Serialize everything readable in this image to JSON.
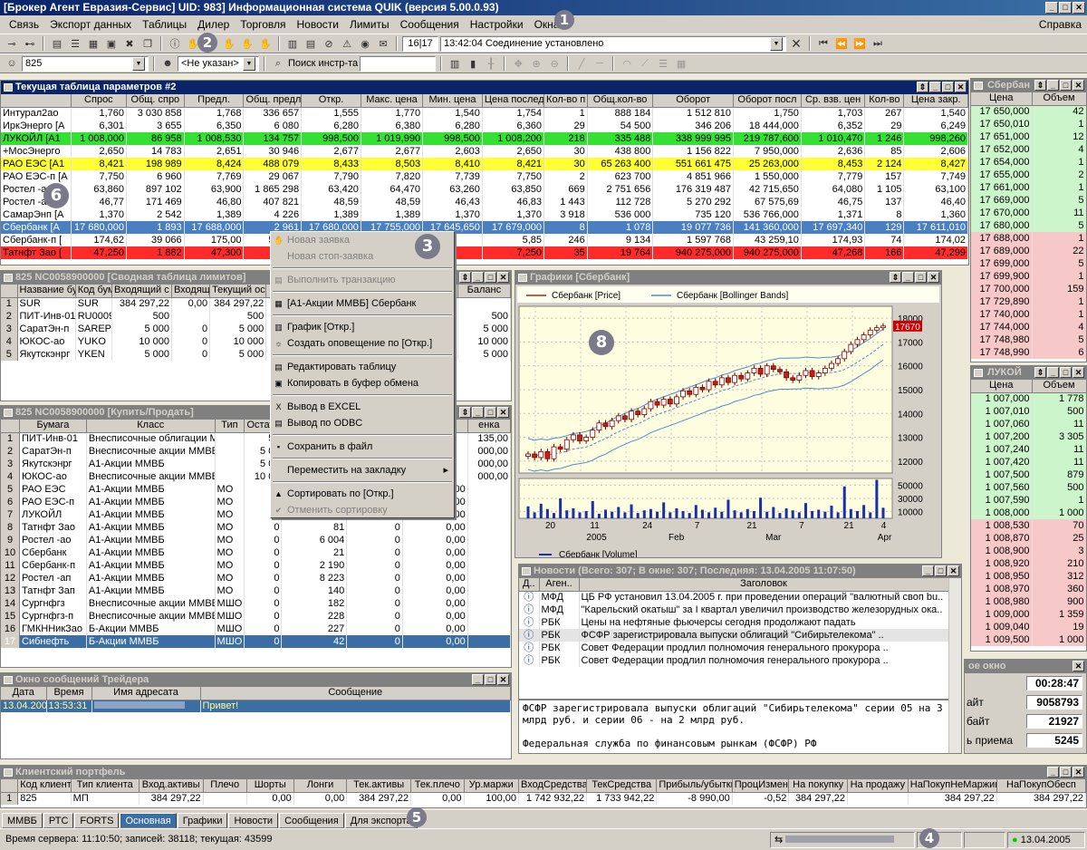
{
  "window": {
    "title": "[Брокер Агент Евразия-Сервис] UID: 983] Информационная система QUIK (версия 5.00.0.93)"
  },
  "menu": {
    "items": [
      "Связь",
      "Экспорт данных",
      "Таблицы",
      "Дилер",
      "Торговля",
      "Новости",
      "Лимиты",
      "Сообщения",
      "Настройки",
      "Окна"
    ],
    "help": "Справка"
  },
  "toolbar2": {
    "account": "825",
    "client_combo": "<Не указан>",
    "search_label": "Поиск инстр-та"
  },
  "toolbar1": {
    "counter": "16|17",
    "status": "13:42:04  Соединение установлено"
  },
  "badges": [
    "1",
    "2",
    "3",
    "4",
    "5",
    "6",
    "7",
    "8"
  ],
  "params": {
    "title": "Текущая таблица параметров #2",
    "headers": [
      "",
      "Спрос",
      "Общ. спро",
      "Предл.",
      "Общ. предл",
      "Откр.",
      "Макс. цена",
      "Мин. цена",
      "Цена послед",
      "Кол-во п",
      "Общ.кол-во",
      "Оборот",
      "Оборот посл",
      "Ср. взв. цен",
      "Кол-во",
      "Цена закр."
    ],
    "rows": [
      {
        "c": [
          "Интурал2ао",
          "1,760",
          "3 030 858",
          "1,768",
          "336 657",
          "1,555",
          "1,770",
          "1,540",
          "1,754",
          "1",
          "888 184",
          "1 512 810",
          "1,750",
          "1,703",
          "267",
          "1,540"
        ],
        "bg": "#ffffff"
      },
      {
        "c": [
          "ИркЭнерго [A",
          "6,301",
          "3 655",
          "6,350",
          "6 080",
          "6,280",
          "6,380",
          "6,280",
          "6,360",
          "29",
          "54 500",
          "346 206",
          "18 444,000",
          "6,352",
          "29",
          "6,249"
        ],
        "bg": "#ffffff"
      },
      {
        "c": [
          "ЛУКОЙЛ [A1",
          "1 008,000",
          "86 958",
          "1 008,530",
          "134 757",
          "998,500",
          "1 019,990",
          "998,500",
          "1 008,200",
          "218",
          "335 488",
          "338 999 995",
          "219 787,600",
          "1 010,470",
          "1 246",
          "998,260"
        ],
        "bg": "#33e033"
      },
      {
        "c": [
          "+МосЭнерго",
          "2,650",
          "14 783",
          "2,651",
          "30 946",
          "2,677",
          "2,677",
          "2,603",
          "2,650",
          "30",
          "438 800",
          "1 156 822",
          "7 950,000",
          "2,636",
          "85",
          "2,606"
        ],
        "bg": "#ffffff"
      },
      {
        "c": [
          "РАО ЕЭС [A1",
          "8,421",
          "198 989",
          "8,424",
          "488 079",
          "8,433",
          "8,503",
          "8,410",
          "8,421",
          "30",
          "65 263 400",
          "551 661 475",
          "25 263,000",
          "8,453",
          "2 124",
          "8,427"
        ],
        "bg": "#ffff33"
      },
      {
        "c": [
          "РАО ЕЭС-п [А",
          "7,750",
          "6 960",
          "7,769",
          "29 067",
          "7,790",
          "7,820",
          "7,739",
          "7,750",
          "2",
          "623 700",
          "4 851 966",
          "1 550,000",
          "7,779",
          "157",
          "7,749"
        ],
        "bg": "#ffffff"
      },
      {
        "c": [
          "Ростел -ао",
          "63,860",
          "897 102",
          "63,900",
          "1 865 298",
          "63,420",
          "64,470",
          "63,260",
          "63,850",
          "669",
          "2 751 656",
          "176 319 487",
          "42 715,650",
          "64,080",
          "1 105",
          "63,100"
        ],
        "bg": "#ffffff"
      },
      {
        "c": [
          "Ростел -ап",
          "46,77",
          "171 469",
          "46,80",
          "407 821",
          "48,59",
          "48,59",
          "46,43",
          "46,83",
          "1 443",
          "112 728",
          "5 270 292",
          "67 575,69",
          "46,75",
          "137",
          "46,40"
        ],
        "bg": "#ffffff"
      },
      {
        "c": [
          "СамарЭнп [A",
          "1,370",
          "2 542",
          "1,389",
          "4 226",
          "1,389",
          "1,389",
          "1,370",
          "1,370",
          "3 918",
          "536 000",
          "735 120",
          "536 766,000",
          "1,371",
          "8",
          "1,360"
        ],
        "bg": "#ffffff"
      },
      {
        "c": [
          "Сбербанк [А",
          "17 680,000",
          "1 893",
          "17 688,000",
          "2 961",
          "17 680,000",
          "17 755,000",
          "17 645,650",
          "17 679,000",
          "8",
          "1 078",
          "19 077 736",
          "141 360,000",
          "17 697,340",
          "129",
          "17 611,010"
        ],
        "bg": "#4a7fc0",
        "fg": "#ffffff"
      },
      {
        "c": [
          "Сбербанк-п [",
          "174,62",
          "39 066",
          "175,00",
          "59 249",
          "",
          "",
          "",
          "5,85",
          "246",
          "9 134",
          "1 597 768",
          "43 259,10",
          "174,93",
          "74",
          "174,02"
        ],
        "bg": "#ffffff"
      },
      {
        "c": [
          "Татнфт Зао [",
          "47,250",
          "1 882",
          "47,300",
          "2 168",
          "",
          "",
          "",
          "7,250",
          "35",
          "19 764",
          "940 275,000",
          "940 275,000",
          "47,268",
          "166",
          "47,299"
        ],
        "bg": "#ff2a2a"
      }
    ]
  },
  "limits": {
    "title": "825 NC0058900000 [Сводная таблица лимитов]",
    "headers": [
      "",
      "Название бум",
      "Код бум",
      "Входящий с",
      "Входящ",
      "Текущий ос",
      "Те"
    ],
    "balance_header": "Баланс",
    "rows": [
      [
        "1",
        "SUR",
        "SUR",
        "384 297,22",
        "0,00",
        "384 297,22"
      ],
      [
        "2",
        "ПИТ-Инв-01",
        "RU0009",
        "500",
        "",
        "500"
      ],
      [
        "3",
        "СаратЭн-п",
        "SAREP",
        "5 000",
        "0",
        "5 000"
      ],
      [
        "4",
        "ЮКОС-ао",
        "YUKO",
        "10 000",
        "0",
        "10 000"
      ],
      [
        "5",
        "Якутскэнрг",
        "YKEN",
        "5 000",
        "0",
        "5 000"
      ]
    ],
    "balances": [
      "",
      "500",
      "5 000",
      "10 000",
      "5 000"
    ]
  },
  "buysell": {
    "title": "825 NC0058900000 [Купить/Продать]",
    "headers": [
      "",
      "Бумага",
      "Класс",
      "Тип",
      "Остато"
    ],
    "right_header": "енка",
    "rows": [
      [
        "1",
        "ПИТ-Инв-01",
        "Внесписочные облигации М",
        "",
        "50"
      ],
      [
        "2",
        "СаратЭн-п",
        "Внесписочные акции ММВБ",
        "",
        "5 00"
      ],
      [
        "3",
        "Якутскэнрг",
        "А1-Акции ММВБ",
        "",
        "5 00"
      ],
      [
        "4",
        "ЮКОС-ао",
        "Внесписочные акции ММВБ",
        "",
        "10 00"
      ],
      [
        "5",
        "РАО ЕЭС",
        "А1-Акции ММВБ",
        "МО",
        "0"
      ],
      [
        "6",
        "РАО ЕЭС-п",
        "А1-Акции ММВБ",
        "МО",
        "0"
      ],
      [
        "7",
        "ЛУКОЙЛ",
        "А1-Акции ММВБ",
        "МО",
        "0"
      ],
      [
        "8",
        "Татнфт Зао",
        "А1-Акции ММВБ",
        "МО",
        "0"
      ],
      [
        "9",
        "Ростел -ао",
        "А1-Акции ММВБ",
        "МО",
        "0"
      ],
      [
        "10",
        "Сбербанк",
        "А1-Акции ММВБ",
        "МО",
        "0"
      ],
      [
        "11",
        "Сбербанк-п",
        "А1-Акции ММВБ",
        "МО",
        "0"
      ],
      [
        "12",
        "Ростел -ап",
        "А1-Акции ММВБ",
        "МО",
        "0"
      ],
      [
        "13",
        "Татнфт Зап",
        "А1-Акции ММВБ",
        "МО",
        "0"
      ],
      [
        "14",
        "Сургнфгз",
        "Внесписочные акции ММВЕ",
        "МШО",
        "0"
      ],
      [
        "15",
        "Сургнфгз-п",
        "Внесписочные акции ММВЕ",
        "МШО",
        "0"
      ],
      [
        "16",
        "ГМКННикЗао",
        "Б-Акции ММВБ",
        "МШО",
        "0"
      ],
      [
        "17",
        "Сибнефть",
        "Б-Акции ММВБ",
        "МШО",
        "0"
      ]
    ],
    "col6": [
      "",
      "",
      "",
      "",
      "0",
      "0",
      "0",
      "81",
      "6 004",
      "21",
      "2 190",
      "8 223",
      "140",
      "182",
      "228",
      "227",
      "42"
    ],
    "col7": [
      "",
      "",
      "",
      "",
      "0",
      "0",
      "0",
      "0",
      "0",
      "0",
      "0",
      "0",
      "0",
      "0",
      "0",
      "0",
      "0"
    ],
    "col8": [
      "",
      "",
      "",
      "",
      "0,00",
      "0,00",
      "0,00",
      "0,00",
      "0,00",
      "0,00",
      "0,00",
      "0,00",
      "0,00",
      "0,00",
      "0,00",
      "0,00",
      "0,00"
    ],
    "col9": [
      "135,00",
      "000,00",
      "000,00",
      "000,00",
      "",
      "",
      "",
      "",
      "",
      "",
      "",
      "",
      "",
      "",
      "",
      "",
      ""
    ]
  },
  "context_menu": {
    "items": [
      {
        "label": "Новая заявка",
        "dis": true,
        "icon": "✋"
      },
      {
        "label": "Новая стоп-заявка",
        "dis": true,
        "icon": ""
      },
      {
        "sep": true
      },
      {
        "label": "Выполнить транзакцию",
        "dis": true,
        "icon": "▤"
      },
      {
        "sep": true
      },
      {
        "label": "[А1-Акции ММВБ] Сбербанк",
        "dis": false,
        "icon": "▦"
      },
      {
        "sep": true
      },
      {
        "label": "График [Откр.]",
        "dis": false,
        "icon": "▥"
      },
      {
        "label": "Создать оповещение по [Откр.]",
        "dis": false,
        "icon": "☼"
      },
      {
        "sep": true
      },
      {
        "label": "Редактировать таблицу",
        "dis": false,
        "icon": "▤"
      },
      {
        "label": "Копировать в буфер обмена",
        "dis": false,
        "icon": "▣"
      },
      {
        "sep": true
      },
      {
        "label": "Вывод в EXCEL",
        "dis": false,
        "icon": "X"
      },
      {
        "label": "Вывод по ODBC",
        "dis": false,
        "icon": "▤"
      },
      {
        "sep": true
      },
      {
        "label": "Сохранить в файл",
        "dis": false,
        "icon": "▪"
      },
      {
        "sep": true
      },
      {
        "label": "Переместить на закладку",
        "dis": false,
        "icon": "",
        "arrow": "▸"
      },
      {
        "sep": true
      },
      {
        "label": "Сортировать по [Откр.]",
        "dis": false,
        "icon": "▲"
      },
      {
        "label": "Отменить сортировку",
        "dis": true,
        "icon": "✔"
      }
    ]
  },
  "chart": {
    "title": "Графики [Сбербанк]",
    "legend_price": "Сбербанк [Price]",
    "legend_bb": "Сбербанк [Bollinger Bands]",
    "legend_volume": "Сбербанк [Volume]",
    "last_price": "17670"
  },
  "chart_data": {
    "type": "line",
    "y_ticks": [
      "18000",
      "17000",
      "16000",
      "15000",
      "14000",
      "13000",
      "12000"
    ],
    "ylim": [
      11500,
      18500
    ],
    "vol_ticks": [
      "50000",
      "30000",
      "10000"
    ],
    "vol_ylim": [
      0,
      60000
    ],
    "x_day_labels": [
      "20",
      "11",
      "24",
      "7",
      "21",
      "7",
      "21",
      "4"
    ],
    "x_month_labels": [
      "2005",
      "Feb",
      "Mar",
      "Apr"
    ],
    "series": [
      {
        "name": "Сбербанк [Price]",
        "values": [
          12300,
          12150,
          12400,
          12100,
          12600,
          12500,
          12900,
          13100,
          12850,
          13000,
          13300,
          13600,
          13450,
          13700,
          13900,
          13750,
          14100,
          13950,
          14200,
          14500,
          14350,
          14600,
          14400,
          14700,
          14950,
          14800,
          15100,
          15000,
          15350,
          15200,
          15500,
          15300,
          15600,
          15450,
          15700,
          15900,
          15650,
          16000,
          15850,
          15750,
          15500,
          15400,
          15600,
          15800,
          15550,
          15700,
          15900,
          16100,
          16300,
          16600,
          16900,
          17100,
          17300,
          17500,
          17600,
          17670
        ]
      }
    ],
    "volume": [
      18000,
      9000,
      22000,
      14000,
      8000,
      30000,
      12000,
      15000,
      9000,
      11000,
      26000,
      7000,
      13000,
      10000,
      17000,
      9000,
      21000,
      8000,
      12000,
      14000,
      10000,
      24000,
      9000,
      15000,
      11000,
      8000,
      20000,
      13000,
      9000,
      16000,
      10000,
      28000,
      12000,
      9000,
      14000,
      11000,
      31000,
      10000,
      17000,
      8000,
      15000,
      12000,
      9000,
      23000,
      11000,
      13000,
      10000,
      19000,
      9000,
      48000,
      14000,
      11000,
      20000,
      9000,
      58000,
      16000
    ]
  },
  "orderbook1": {
    "title": "Сбербан",
    "headers": [
      "Цена",
      "Объем"
    ],
    "bids": [
      [
        "17 650,000",
        "42"
      ],
      [
        "17 650,010",
        "1"
      ],
      [
        "17 651,000",
        "12"
      ],
      [
        "17 652,000",
        "4"
      ],
      [
        "17 654,000",
        "1"
      ],
      [
        "17 655,000",
        "2"
      ],
      [
        "17 661,000",
        "1"
      ],
      [
        "17 669,000",
        "5"
      ],
      [
        "17 670,000",
        "11"
      ],
      [
        "17 680,000",
        "5"
      ]
    ],
    "asks": [
      [
        "17 688,000",
        "1"
      ],
      [
        "17 689,000",
        "22"
      ],
      [
        "17 699,000",
        "5"
      ],
      [
        "17 699,900",
        "1"
      ],
      [
        "17 700,000",
        "159"
      ],
      [
        "17 729,890",
        "1"
      ],
      [
        "17 740,000",
        "1"
      ],
      [
        "17 744,000",
        "4"
      ],
      [
        "17 748,980",
        "5"
      ],
      [
        "17 748,990",
        "6"
      ]
    ]
  },
  "orderbook2": {
    "title": "ЛУКОЙ",
    "headers": [
      "Цена",
      "Объем"
    ],
    "bids": [
      [
        "1 007,000",
        "1 778"
      ],
      [
        "1 007,010",
        "500"
      ],
      [
        "1 007,060",
        "11"
      ],
      [
        "1 007,200",
        "3 305"
      ],
      [
        "1 007,240",
        "11"
      ],
      [
        "1 007,420",
        "11"
      ],
      [
        "1 007,500",
        "879"
      ],
      [
        "1 007,560",
        "500"
      ],
      [
        "1 007,590",
        "1"
      ],
      [
        "1 008,000",
        "1 000"
      ]
    ],
    "asks": [
      [
        "1 008,530",
        "70"
      ],
      [
        "1 008,870",
        "25"
      ],
      [
        "1 008,900",
        "3"
      ],
      [
        "1 008,920",
        "210"
      ],
      [
        "1 008,950",
        "312"
      ],
      [
        "1 008,970",
        "360"
      ],
      [
        "1 008,980",
        "900"
      ],
      [
        "1 009,000",
        "1 359"
      ],
      [
        "1 009,040",
        "19"
      ],
      [
        "1 009,500",
        "1 000"
      ]
    ]
  },
  "news": {
    "title": "Новости (Всего: 307; В окне: 307; Последняя: 13.04.2005 11:07:50)",
    "headers": [
      "Д..",
      "Аген..",
      "Заголовок"
    ],
    "rows": [
      [
        "МФД",
        "ЦБ РФ установил 13.04.2005 г. при проведении операций \"валютный своп bu.."
      ],
      [
        "МФД",
        "\"Карельский окатыш\" за I квартал увеличил производство железорудных ока.."
      ],
      [
        "РБК",
        "Цены на нефтяные фьючерсы сегодня продолжают падать"
      ],
      [
        "РБК",
        "ФСФР зарегистрировала выпуски облигаций \"Сибирьтелекома\" .."
      ],
      [
        "РБК",
        "Совет Федерации продлил полномочия генерального прокурора .."
      ],
      [
        "РБК",
        "Совет Федерации продлил полномочия генерального прокурора .."
      ]
    ],
    "body": "ФСФР зарегистрировала выпуски облигаций \"Сибирьтелекома\" серии 05 на 3 млрд руб. и серии 06 - на 2 млрд руб.\n\nФедеральная служба по финансовым рынкам (ФСФР) РФ"
  },
  "info": {
    "title": "ое окно",
    "rows": [
      [
        "",
        "00:28:47"
      ],
      [
        "айт",
        "9058793"
      ],
      [
        "байт",
        "21927"
      ],
      [
        "ь приема",
        "5245"
      ]
    ]
  },
  "messages": {
    "title": "Окно сообщений Трейдера",
    "headers": [
      "Дата",
      "Время",
      "Имя адресата",
      "Сообщение"
    ],
    "row": [
      "13.04.200",
      "13:53:31",
      "",
      "Привет!"
    ]
  },
  "portfolio": {
    "title": "Клиентский портфель",
    "headers": [
      "",
      "Код клиента",
      "Тип клиента",
      "Вход.активы",
      "Плечо",
      "Шорты",
      "Лонги",
      "Тек.активы",
      "Тек.плечо",
      "Ур.маржи",
      "ВходСредства",
      "ТекСредства",
      "Прибыль/убытки",
      "ПроцИзмен",
      "На покупку",
      "На продажу",
      "НаПокупНеМаржин",
      "НаПокупОбесп"
    ],
    "row": [
      "1",
      "825",
      "МП",
      "384 297,22",
      "",
      "0,00",
      "0,00",
      "384 297,22",
      "0,00",
      "100,00",
      "1 742 932,22",
      "1 733 942,22",
      "-8 990,00",
      "-0,52",
      "384 297,22",
      "",
      "384 297,22",
      "384 297,22"
    ]
  },
  "tabs": [
    "ММВБ",
    "РТС",
    "FORTS",
    "Основная",
    "Графики",
    "Новости",
    "Сообщения",
    "Для экспорта"
  ],
  "status": {
    "server": "Время сервера: 11:10:50; записей: 38118; текущая: 43599",
    "date": "13.04.2005"
  }
}
